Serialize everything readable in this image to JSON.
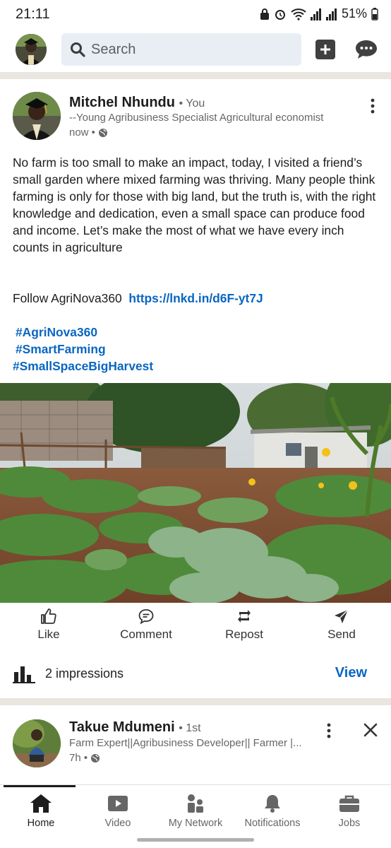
{
  "status_bar": {
    "time": "21:11",
    "battery": "51%",
    "icons": [
      "lock-icon",
      "alarm-icon",
      "wifi-icon",
      "signal-icon",
      "signal-icon",
      "battery-icon"
    ]
  },
  "top_bar": {
    "search_placeholder": "Search",
    "icons": [
      "avatar",
      "search-icon",
      "plus-icon",
      "messaging-icon"
    ]
  },
  "post": {
    "author": "Mitchel Nhundu",
    "degree": "• You",
    "headline": "--Young Agribusiness Specialist Agricultural economist",
    "time": "now •",
    "body_text": "No farm is too small to make an impact, today, I visited a friend’s small garden where mixed farming was thriving. Many people think farming is only for those with big land, but the truth is, with the right knowledge and dedication, even a small space can produce food and income. Let’s make the most of what we have every inch counts in agriculture",
    "follow_text": "Follow AgriNova360",
    "link": "https://lnkd.in/d6F-yt7J",
    "hashtags": [
      "#AgriNova360",
      "#SmartFarming",
      "#SmallSpaceBigHarvest"
    ],
    "actions": {
      "like": "Like",
      "comment": "Comment",
      "repost": "Repost",
      "send": "Send"
    },
    "impressions": "2 impressions",
    "view_label": "View"
  },
  "post2": {
    "author": "Takue Mdumeni",
    "degree": "• 1st",
    "headline": "Farm Expert||Agribusiness Developer|| Farmer |...",
    "time": "7h •"
  },
  "bottom_nav": {
    "items": [
      {
        "label": "Home",
        "active": true
      },
      {
        "label": "Video",
        "active": false
      },
      {
        "label": "My Network",
        "active": false
      },
      {
        "label": "Notifications",
        "active": false
      },
      {
        "label": "Jobs",
        "active": false
      }
    ]
  },
  "colors": {
    "link_blue": "#0a66c2",
    "search_bg": "#e8eef4",
    "divider": "#e9e5df"
  }
}
